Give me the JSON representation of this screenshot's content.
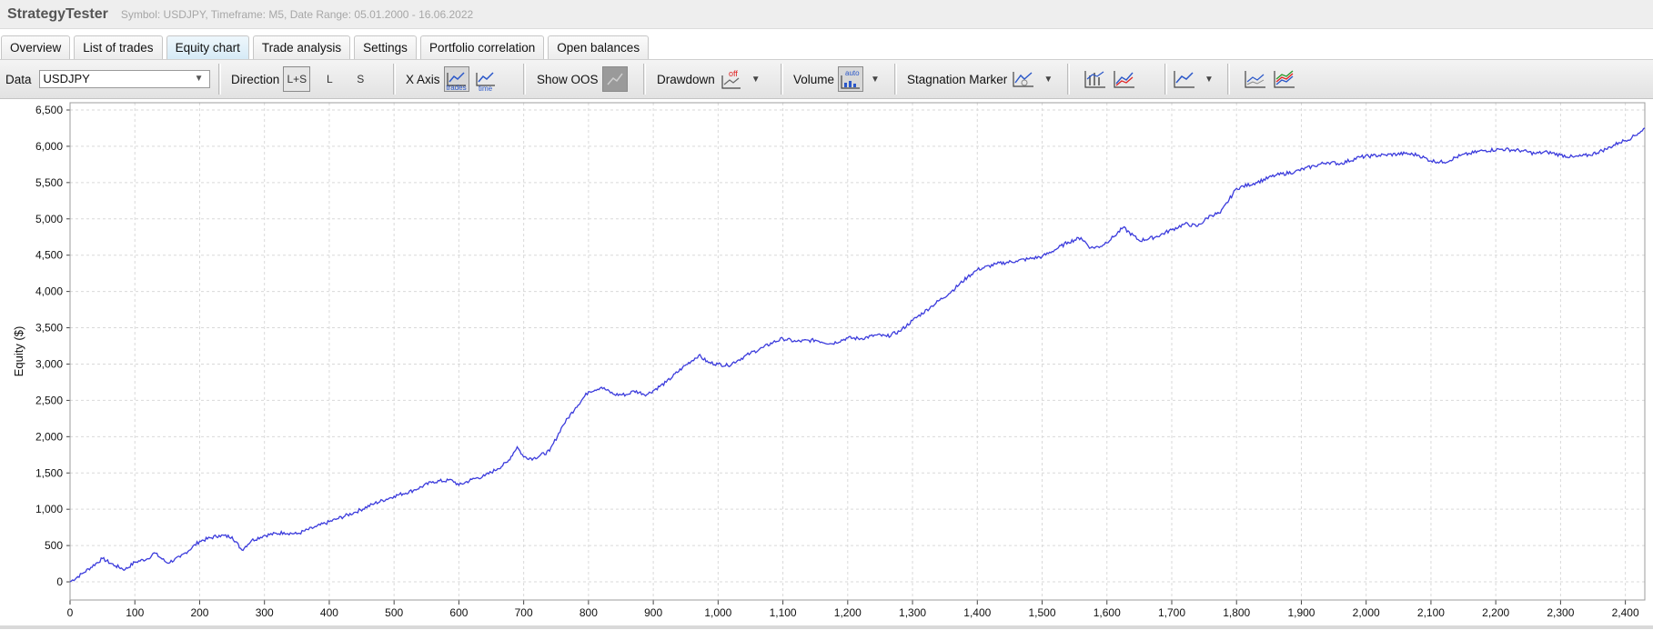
{
  "app": {
    "title": "StrategyTester",
    "subtitle": "Symbol: USDJPY, Timeframe: M5, Date Range: 05.01.2000 - 16.06.2022"
  },
  "tabs": [
    {
      "label": "Overview",
      "active": false
    },
    {
      "label": "List of trades",
      "active": false
    },
    {
      "label": "Equity chart",
      "active": true
    },
    {
      "label": "Trade analysis",
      "active": false
    },
    {
      "label": "Settings",
      "active": false
    },
    {
      "label": "Portfolio correlation",
      "active": false
    },
    {
      "label": "Open balances",
      "active": false
    }
  ],
  "toolbar": {
    "data_label": "Data",
    "data_value": "USDJPY",
    "direction_label": "Direction",
    "direction_options": [
      "L+S",
      "L",
      "S"
    ],
    "xaxis_label": "X Axis",
    "xaxis_trades_icon_text": "trades",
    "xaxis_time_icon_text": "time",
    "show_oos_label": "Show OOS",
    "drawdown_label": "Drawdown",
    "drawdown_icon_text": "off",
    "volume_label": "Volume",
    "volume_icon_text": "auto",
    "stagnation_label": "Stagnation Marker"
  },
  "icons": [
    "dropdown-arrow-icon",
    "trades-axis-icon",
    "time-axis-icon",
    "oos-icon",
    "drawdown-off-icon",
    "volume-auto-icon",
    "stagnation-marker-icon",
    "bar-chart-icon",
    "equity-line-icon",
    "line-chart-icon",
    "scatter-chart-icon",
    "multi-line-chart-icon"
  ],
  "colors": {
    "equity_line": "#3b3bdc",
    "grid": "#d9d9d9",
    "drawdown_off": "#e02020",
    "icon_blue": "#2a57c9"
  },
  "chart_data": {
    "type": "line",
    "title": "",
    "xlabel": "",
    "ylabel": "Equity ($)",
    "xlim": [
      0,
      2430
    ],
    "ylim": [
      -250,
      6600
    ],
    "x_ticks": [
      0,
      100,
      200,
      300,
      400,
      500,
      600,
      700,
      800,
      900,
      1000,
      1100,
      1200,
      1300,
      1400,
      1500,
      1600,
      1700,
      1800,
      1900,
      2000,
      2100,
      2200,
      2300,
      2400
    ],
    "x_tick_labels": [
      "0",
      "100",
      "200",
      "300",
      "400",
      "500",
      "600",
      "700",
      "800",
      "900",
      "1,000",
      "1,100",
      "1,200",
      "1,300",
      "1,400",
      "1,500",
      "1,600",
      "1,700",
      "1,800",
      "1,900",
      "2,000",
      "2,100",
      "2,200",
      "2,300",
      "2,400"
    ],
    "y_ticks": [
      0,
      500,
      1000,
      1500,
      2000,
      2500,
      3000,
      3500,
      4000,
      4500,
      5000,
      5500,
      6000,
      6500
    ],
    "y_tick_labels": [
      "0",
      "500",
      "1,000",
      "1,500",
      "2,000",
      "2,500",
      "3,000",
      "3,500",
      "4,000",
      "4,500",
      "5,000",
      "5,500",
      "6,000",
      "6,500"
    ],
    "grid": true,
    "series": [
      {
        "x": [
          0,
          20,
          50,
          70,
          85,
          100,
          120,
          130,
          150,
          170,
          200,
          230,
          250,
          265,
          280,
          300,
          330,
          350,
          380,
          410,
          440,
          470,
          500,
          530,
          560,
          590,
          600,
          620,
          640,
          660,
          675,
          690,
          700,
          715,
          740,
          760,
          780,
          800,
          820,
          840,
          860,
          870,
          890,
          920,
          945,
          970,
          985,
          1000,
          1015,
          1030,
          1050,
          1070,
          1085,
          1100,
          1120,
          1150,
          1175,
          1200,
          1220,
          1245,
          1260,
          1280,
          1300,
          1330,
          1360,
          1385,
          1400,
          1430,
          1460,
          1480,
          1500,
          1525,
          1540,
          1560,
          1575,
          1590,
          1610,
          1625,
          1650,
          1675,
          1700,
          1720,
          1740,
          1760,
          1775,
          1800,
          1830,
          1860,
          1890,
          1920,
          1940,
          1960,
          1990,
          2010,
          2030,
          2060,
          2080,
          2100,
          2120,
          2145,
          2160,
          2180,
          2210,
          2240,
          2260,
          2280,
          2300,
          2320,
          2345,
          2370,
          2390,
          2410,
          2420,
          2430
        ],
        "y": [
          0,
          120,
          320,
          220,
          170,
          270,
          320,
          400,
          260,
          340,
          560,
          640,
          620,
          440,
          570,
          640,
          680,
          660,
          760,
          860,
          960,
          1080,
          1180,
          1260,
          1380,
          1400,
          1330,
          1410,
          1460,
          1560,
          1650,
          1860,
          1720,
          1700,
          1800,
          2150,
          2400,
          2620,
          2680,
          2580,
          2580,
          2630,
          2580,
          2750,
          2950,
          3120,
          3020,
          3000,
          2980,
          3050,
          3150,
          3230,
          3300,
          3350,
          3310,
          3330,
          3280,
          3360,
          3350,
          3400,
          3380,
          3450,
          3600,
          3800,
          4000,
          4200,
          4300,
          4380,
          4420,
          4450,
          4480,
          4600,
          4680,
          4740,
          4600,
          4620,
          4750,
          4880,
          4700,
          4750,
          4850,
          4930,
          4900,
          5050,
          5080,
          5420,
          5500,
          5600,
          5650,
          5730,
          5780,
          5760,
          5850,
          5870,
          5880,
          5900,
          5880,
          5800,
          5780,
          5870,
          5900,
          5940,
          5960,
          5940,
          5900,
          5920,
          5880,
          5850,
          5880,
          5960,
          6050,
          6120,
          6180,
          6250
        ]
      }
    ]
  }
}
